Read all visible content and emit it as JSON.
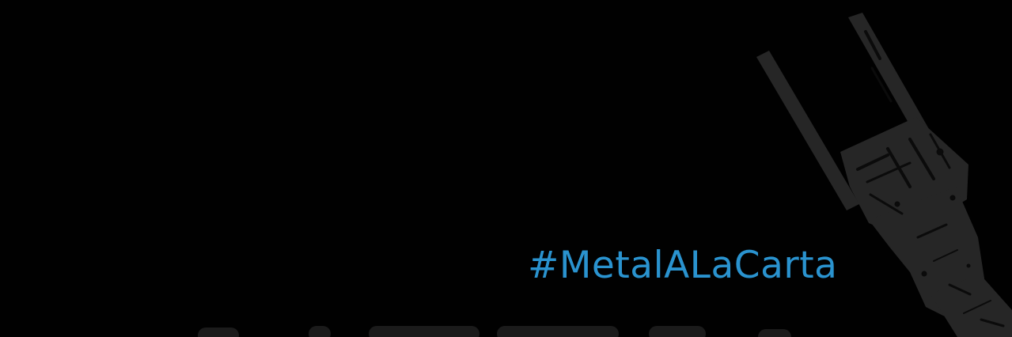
{
  "banner": {
    "hashtag": "#MetalALaCarta"
  },
  "logo": {
    "icon": "fork-horns-icon"
  },
  "colors": {
    "background": "#010101",
    "hashtag": "#2a93cf",
    "logo": "#262626",
    "logo_distress": "#0b0b0b"
  }
}
